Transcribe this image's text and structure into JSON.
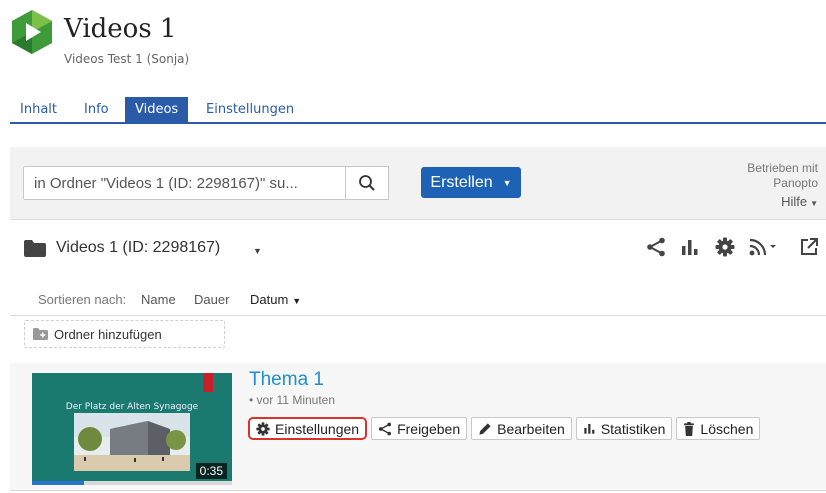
{
  "course": {
    "title": "Videos 1",
    "subtitle": "Videos Test 1 (Sonja)"
  },
  "tabs": [
    {
      "label": "Inhalt",
      "active": false
    },
    {
      "label": "Info",
      "active": false
    },
    {
      "label": "Videos",
      "active": true
    },
    {
      "label": "Einstellungen",
      "active": false
    }
  ],
  "toolbar": {
    "search_value": "in Ordner \"Videos 1 (ID: 2298167)\" su...",
    "create_label": "Erstellen",
    "powered_line1": "Betrieben mit",
    "powered_line2": "Panopto",
    "help_label": "Hilfe"
  },
  "folder": {
    "name": "Videos 1 (ID: 2298167)",
    "actions": [
      "share-icon",
      "stats-icon",
      "gear-icon",
      "rss-icon",
      "open-external-icon"
    ]
  },
  "sort": {
    "label": "Sortieren nach:",
    "options": [
      "Name",
      "Dauer",
      "Datum"
    ],
    "active": "Datum"
  },
  "add_folder_label": "Ordner hinzufügen",
  "session": {
    "title": "Thema 1",
    "meta": "• vor 11 Minuten",
    "thumbnail_title": "Der Platz der Alten Synagoge",
    "duration": "0:35",
    "buttons": {
      "settings": "Einstellungen",
      "share": "Freigeben",
      "edit": "Bearbeiten",
      "stats": "Statistiken",
      "delete": "Löschen"
    }
  },
  "colors": {
    "accent": "#2a5ba8",
    "create_button": "#1d62b5",
    "link": "#1e8fcc",
    "highlight": "#d9342b"
  }
}
